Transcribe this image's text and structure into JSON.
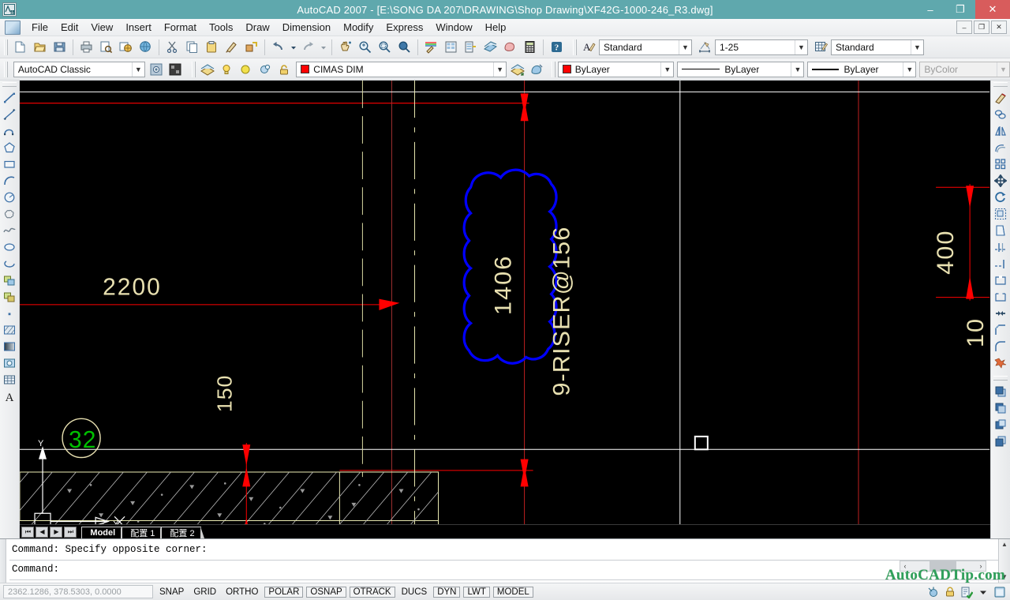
{
  "window": {
    "title": "AutoCAD 2007 - [E:\\SONG DA 207\\DRAWING\\Shop Drawing\\XF42G-1000-246_R3.dwg]",
    "app_icon": "autocad-icon",
    "minimize": "–",
    "maximize": "❐",
    "close": "✕",
    "doc_minimize": "–",
    "doc_restore": "❐",
    "doc_close": "✕",
    "titlebar_color": "#5fa8ad",
    "close_color": "#d85c5c"
  },
  "menu": {
    "items": [
      {
        "label": "File"
      },
      {
        "label": "Edit"
      },
      {
        "label": "View"
      },
      {
        "label": "Insert"
      },
      {
        "label": "Format"
      },
      {
        "label": "Tools"
      },
      {
        "label": "Draw"
      },
      {
        "label": "Dimension"
      },
      {
        "label": "Modify"
      },
      {
        "label": "Express"
      },
      {
        "label": "Window"
      },
      {
        "label": "Help"
      }
    ]
  },
  "standard_toolbar": {
    "buttons": [
      {
        "name": "new-icon"
      },
      {
        "name": "open-icon"
      },
      {
        "name": "save-icon"
      },
      {
        "name": "plot-icon"
      },
      {
        "name": "plot-preview-icon"
      },
      {
        "name": "publish-icon"
      },
      {
        "name": "etransmit-icon"
      },
      {
        "name": "cut-icon"
      },
      {
        "name": "copy-icon"
      },
      {
        "name": "paste-icon"
      },
      {
        "name": "match-properties-icon"
      },
      {
        "name": "block-editor-icon"
      },
      {
        "name": "undo-icon"
      },
      {
        "name": "undo-dropdown-icon"
      },
      {
        "name": "redo-icon"
      },
      {
        "name": "redo-dropdown-icon"
      },
      {
        "name": "pan-realtime-icon"
      },
      {
        "name": "zoom-realtime-icon"
      },
      {
        "name": "zoom-window-icon"
      },
      {
        "name": "zoom-previous-icon"
      },
      {
        "name": "properties-icon"
      },
      {
        "name": "designcenter-icon"
      },
      {
        "name": "tool-palettes-icon"
      },
      {
        "name": "sheet-set-manager-icon"
      },
      {
        "name": "markup-set-manager-icon"
      },
      {
        "name": "quickcalc-icon"
      },
      {
        "name": "help-icon"
      }
    ]
  },
  "styles_toolbar": {
    "text_style": {
      "name": "text-style-combo",
      "value": "Standard",
      "icon": "text-style-icon"
    },
    "dim_style": {
      "name": "dimension-style-combo",
      "value": "1-25",
      "icon": "dim-style-icon"
    },
    "table_style": {
      "name": "table-style-combo",
      "value": "Standard",
      "icon": "table-style-icon"
    }
  },
  "workspace_toolbar": {
    "workspace": {
      "name": "workspace-combo",
      "value": "AutoCAD Classic"
    },
    "buttons": [
      {
        "name": "workspace-settings-icon"
      },
      {
        "name": "my-workspace-icon"
      }
    ]
  },
  "layers_toolbar": {
    "layer_properties_icon": "layer-properties-manager-icon",
    "state_icons": [
      {
        "name": "layer-on-bulb-icon",
        "color": "#ffd84d"
      },
      {
        "name": "layer-freeze-sun-icon",
        "color": "#e8e04a"
      },
      {
        "name": "layer-freeze-viewport-icon",
        "color": "#9ec6e8"
      },
      {
        "name": "layer-lock-icon",
        "color": "#d8b33a"
      }
    ],
    "layer_color": "#ff0000",
    "current_layer": "CIMAS DIM",
    "after_buttons": [
      {
        "name": "layer-previous-icon"
      },
      {
        "name": "make-object-layer-current-icon"
      }
    ]
  },
  "properties_toolbar": {
    "color": {
      "name": "object-color-combo",
      "value": "ByLayer",
      "swatch": "#ff0000"
    },
    "linetype": {
      "name": "linetype-combo",
      "value": "ByLayer"
    },
    "lineweight": {
      "name": "lineweight-combo",
      "value": "ByLayer"
    },
    "plotstyle": {
      "name": "plot-style-combo",
      "value": "ByColor",
      "disabled": true
    }
  },
  "draw_toolbar": {
    "buttons": [
      {
        "name": "line-icon"
      },
      {
        "name": "construction-line-icon"
      },
      {
        "name": "polyline-icon"
      },
      {
        "name": "polygon-icon"
      },
      {
        "name": "rectangle-icon"
      },
      {
        "name": "arc-icon"
      },
      {
        "name": "circle-icon"
      },
      {
        "name": "revision-cloud-icon"
      },
      {
        "name": "spline-icon"
      },
      {
        "name": "ellipse-icon"
      },
      {
        "name": "ellipse-arc-icon"
      },
      {
        "name": "insert-block-icon"
      },
      {
        "name": "make-block-icon"
      },
      {
        "name": "point-icon"
      },
      {
        "name": "hatch-icon"
      },
      {
        "name": "gradient-icon"
      },
      {
        "name": "region-icon"
      },
      {
        "name": "table-icon"
      },
      {
        "name": "multiline-text-icon"
      }
    ]
  },
  "modify_toolbar": {
    "buttons": [
      {
        "name": "erase-icon"
      },
      {
        "name": "copy-object-icon"
      },
      {
        "name": "mirror-icon"
      },
      {
        "name": "offset-icon"
      },
      {
        "name": "array-icon"
      },
      {
        "name": "move-icon"
      },
      {
        "name": "rotate-icon"
      },
      {
        "name": "scale-icon"
      },
      {
        "name": "stretch-icon"
      },
      {
        "name": "trim-icon"
      },
      {
        "name": "extend-icon"
      },
      {
        "name": "break-at-point-icon"
      },
      {
        "name": "break-icon"
      },
      {
        "name": "join-icon"
      },
      {
        "name": "chamfer-icon"
      },
      {
        "name": "fillet-icon"
      },
      {
        "name": "explode-icon"
      }
    ],
    "order_buttons": [
      {
        "name": "bring-to-front-icon"
      },
      {
        "name": "send-to-back-icon"
      },
      {
        "name": "bring-above-object-icon"
      },
      {
        "name": "send-under-object-icon"
      }
    ]
  },
  "drawing": {
    "background": "#000000",
    "annotations": [
      {
        "name": "dim-text-2200",
        "text": "2200",
        "color": "#e8e0b0"
      },
      {
        "name": "dim-text-1406",
        "text": "1406",
        "color": "#e8e0b0"
      },
      {
        "name": "note-riser",
        "text": "9-RISER@156",
        "color": "#e8e0b0"
      },
      {
        "name": "dim-text-400",
        "text": "400",
        "color": "#e8e0b0"
      },
      {
        "name": "dim-text-10",
        "text": "10",
        "color": "#e8e0b0"
      },
      {
        "name": "dim-text-150",
        "text": "150",
        "color": "#e8e0b0"
      },
      {
        "name": "detail-bubble-32",
        "text": "32",
        "color": "#00c000"
      }
    ],
    "revision_cloud_color": "#0000ff",
    "dimension_color": "#ff0000",
    "geometry_color": "#ffffff",
    "hatch_color": "#9a9a9a",
    "ucs_label_x": "X",
    "ucs_label_y": "Y"
  },
  "layout_tabs": {
    "nav": [
      {
        "name": "first-layout-button",
        "glyph": "⏮"
      },
      {
        "name": "previous-layout-button",
        "glyph": "◀"
      },
      {
        "name": "next-layout-button",
        "glyph": "▶"
      },
      {
        "name": "last-layout-button",
        "glyph": "⏭"
      }
    ],
    "tabs": [
      {
        "label": "Model",
        "active": true
      },
      {
        "label": "配置 1",
        "active": false
      },
      {
        "label": "配置 2",
        "active": false
      }
    ]
  },
  "command_window": {
    "lines": [
      "Command: Specify opposite corner:",
      "Command:"
    ],
    "scroll_up": "▲",
    "scroll_down": "▼"
  },
  "status_bar": {
    "coordinates": "2362.1286, 378.5303, 0.0000",
    "toggles": [
      {
        "label": "SNAP",
        "framed": false
      },
      {
        "label": "GRID",
        "framed": false
      },
      {
        "label": "ORTHO",
        "framed": false
      },
      {
        "label": "POLAR",
        "framed": true
      },
      {
        "label": "OSNAP",
        "framed": true
      },
      {
        "label": "OTRACK",
        "framed": true
      },
      {
        "label": "DUCS",
        "framed": false
      },
      {
        "label": "DYN",
        "framed": true
      },
      {
        "label": "LWT",
        "framed": true
      },
      {
        "label": "MODEL",
        "framed": true
      }
    ],
    "tray_icons": [
      {
        "name": "communication-center-icon"
      },
      {
        "name": "manage-xrefs-icon"
      },
      {
        "name": "validate-digital-signature-icon"
      },
      {
        "name": "tray-options-arrow-icon"
      },
      {
        "name": "clean-screen-icon"
      }
    ],
    "scroll_left": "‹",
    "scroll_right": "›"
  },
  "watermark": {
    "text": "AutoCADTip.com",
    "color": "#2fa05a"
  }
}
